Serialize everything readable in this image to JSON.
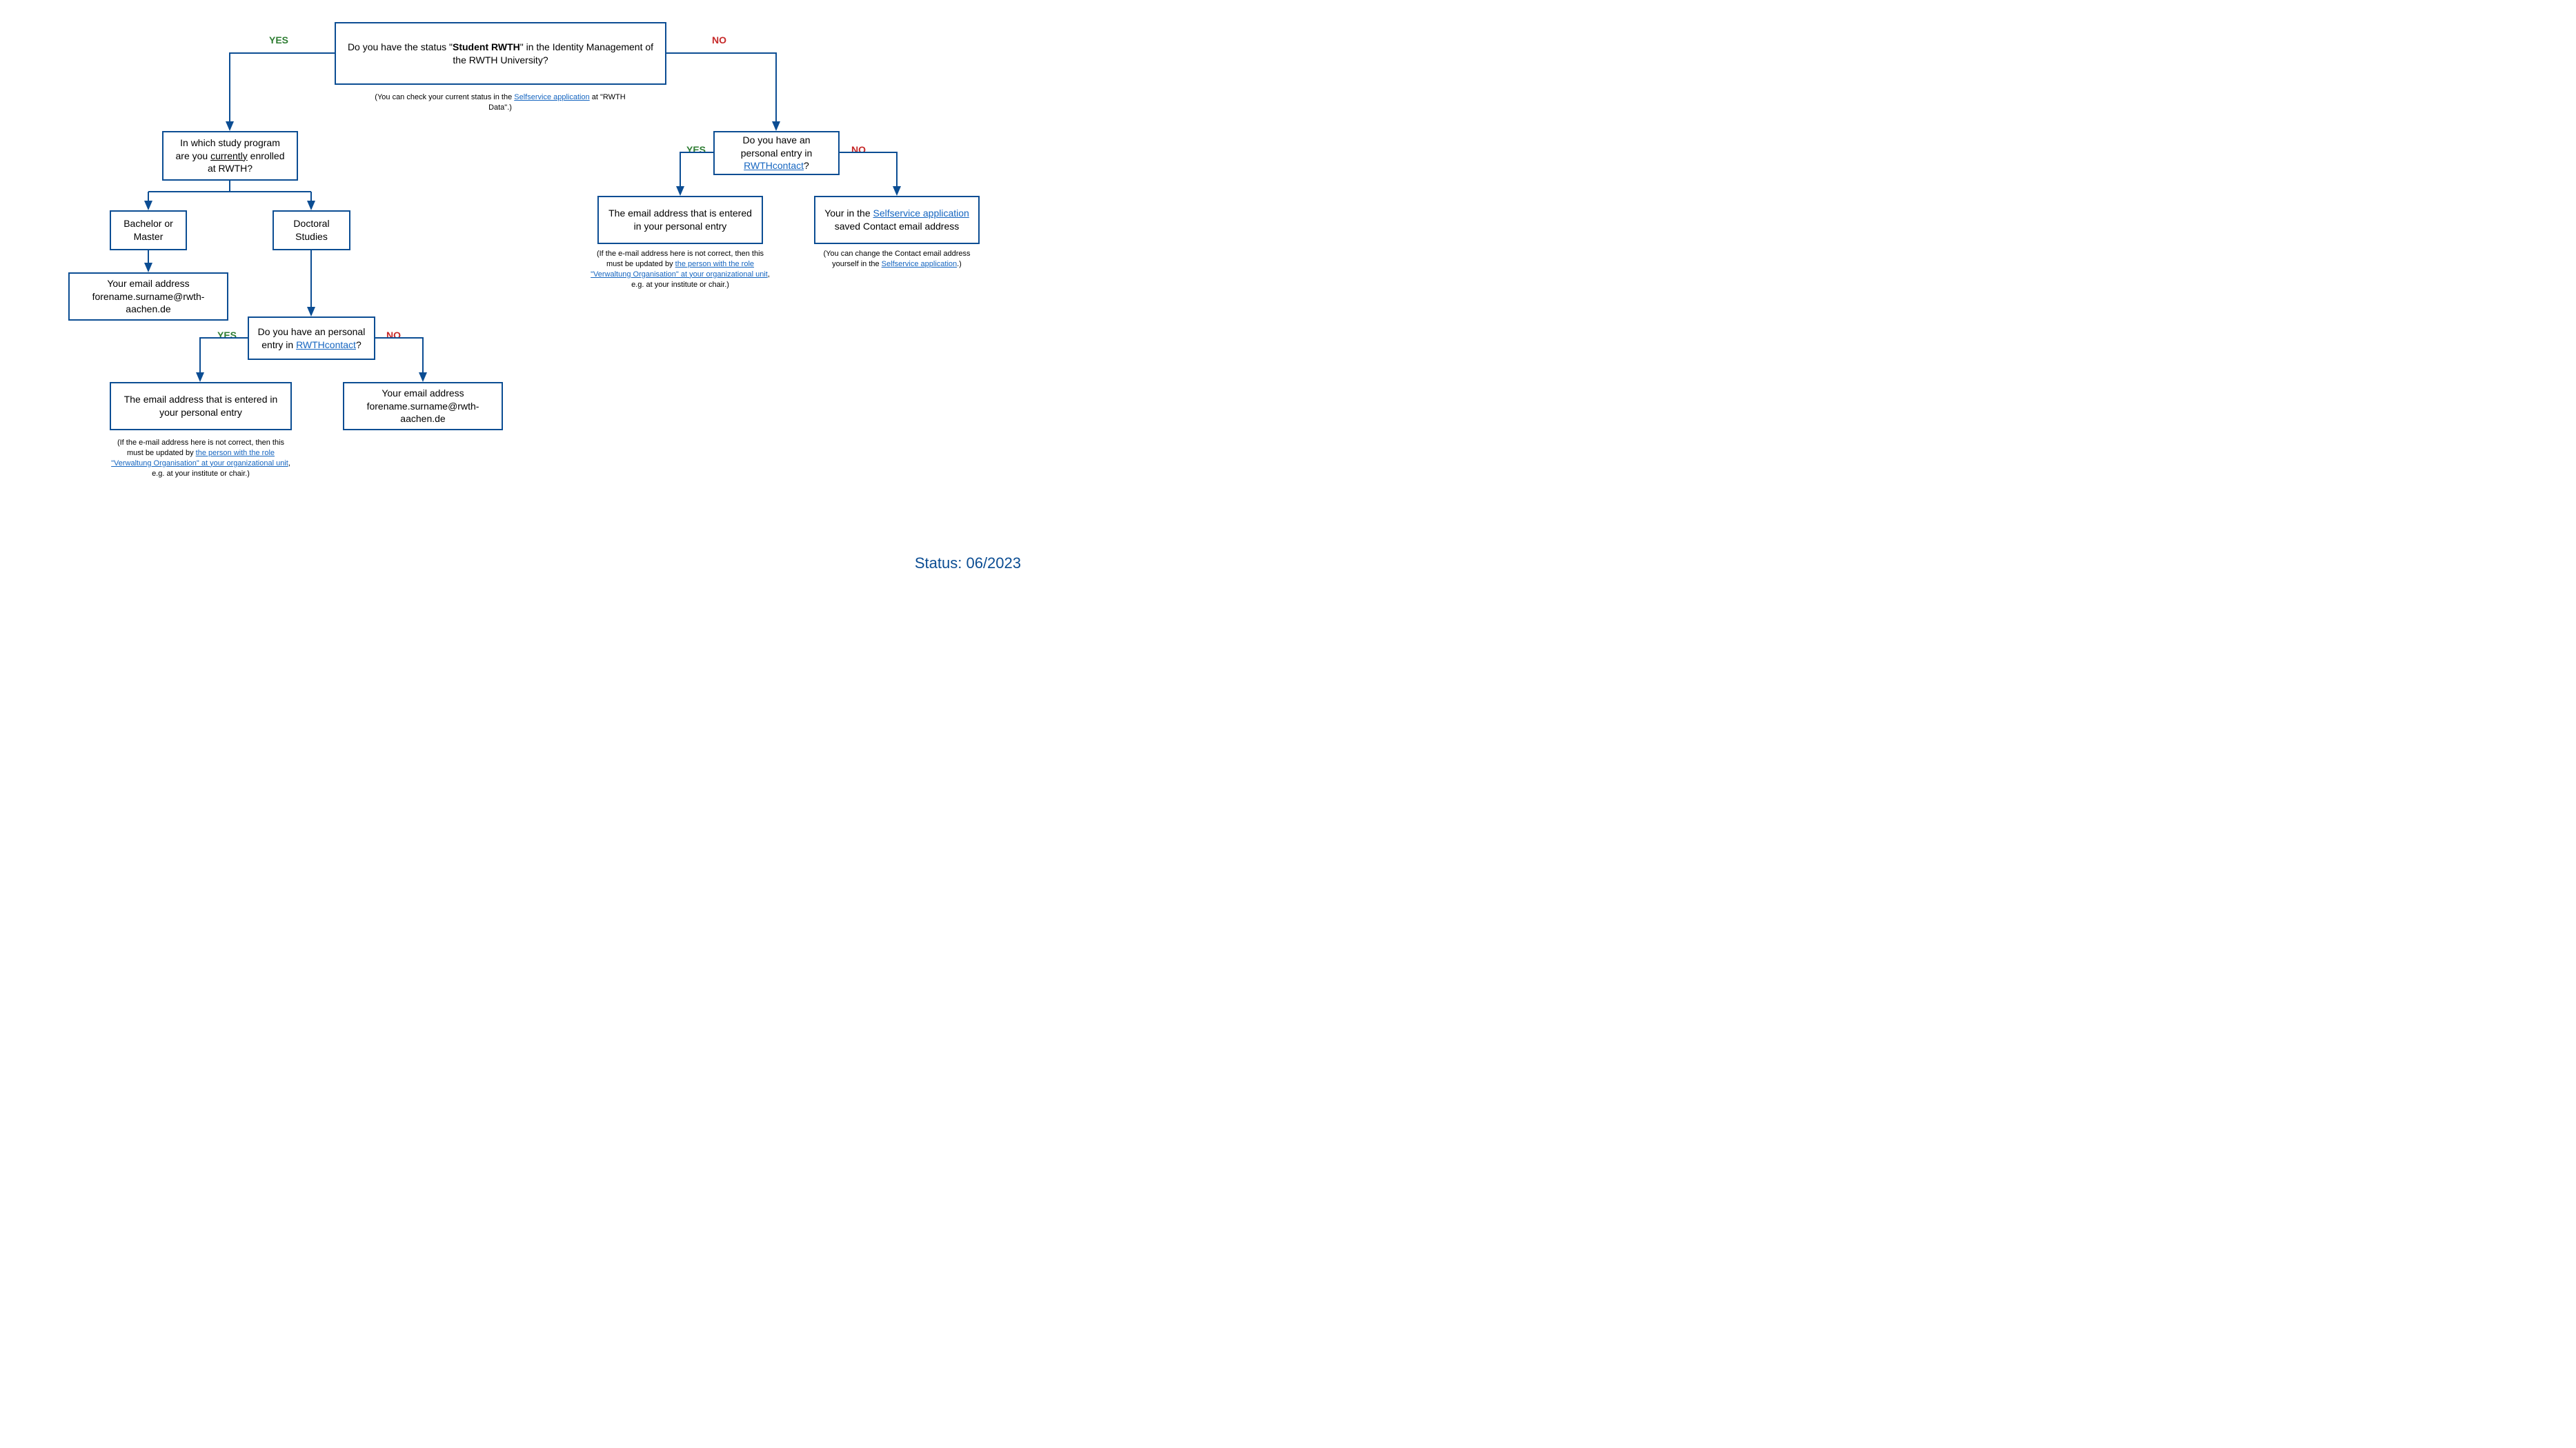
{
  "chart_data": {
    "type": "flowchart",
    "title": "RWTH email address decision tree",
    "nodes": [
      {
        "id": "root",
        "kind": "decision",
        "text": "Do you have the status \"Student RWTH\" in the Identity Management of the RWTH University?",
        "note": "(You can check your current status in the Selfservice application at \"RWTH Data\".)"
      },
      {
        "id": "study",
        "kind": "decision",
        "text": "In which study program are you currently enrolled at RWTH?"
      },
      {
        "id": "bama",
        "kind": "option",
        "text": "Bachelor or Master"
      },
      {
        "id": "phd",
        "kind": "option",
        "text": "Doctoral Studies"
      },
      {
        "id": "emailA",
        "kind": "result",
        "text": "Your email address forename.surname@rwth-aachen.de"
      },
      {
        "id": "contact1",
        "kind": "decision",
        "text": "Do you have an personal entry in RWTHcontact?"
      },
      {
        "id": "emailB",
        "kind": "result",
        "text": "The email address that is entered in your personal entry",
        "note": "(If the e-mail address here is not correct, then this must be updated by the person with the role \"Verwaltung Organisation\" at your organizational unit, e.g. at your institute or chair.)"
      },
      {
        "id": "emailC",
        "kind": "result",
        "text": "Your email address forename.surname@rwth-aachen.de"
      },
      {
        "id": "contact2",
        "kind": "decision",
        "text": "Do you have an personal entry in RWTHcontact?"
      },
      {
        "id": "emailD",
        "kind": "result",
        "text": "The email address that is entered in your personal entry",
        "note": "(If the e-mail address here is not correct, then this must be updated by the person with the role \"Verwaltung Organisation\" at your organizational unit, e.g. at your institute or chair.)"
      },
      {
        "id": "emailE",
        "kind": "result",
        "text": "Your in the Selfservice application saved Contact email address",
        "note": "(You can change the Contact email address yourself in the Selfservice application.)"
      }
    ],
    "edges": [
      {
        "from": "root",
        "to": "study",
        "label": "YES"
      },
      {
        "from": "root",
        "to": "contact2",
        "label": "NO"
      },
      {
        "from": "study",
        "to": "bama",
        "label": ""
      },
      {
        "from": "study",
        "to": "phd",
        "label": ""
      },
      {
        "from": "bama",
        "to": "emailA",
        "label": ""
      },
      {
        "from": "phd",
        "to": "contact1",
        "label": ""
      },
      {
        "from": "contact1",
        "to": "emailB",
        "label": "YES"
      },
      {
        "from": "contact1",
        "to": "emailC",
        "label": "NO"
      },
      {
        "from": "contact2",
        "to": "emailD",
        "label": "YES"
      },
      {
        "from": "contact2",
        "to": "emailE",
        "label": "NO"
      }
    ]
  },
  "labels": {
    "yes": "YES",
    "no": "NO",
    "status": "Status: 06/2023"
  },
  "root": {
    "pre": "Do you have the status \"",
    "bold": "Student RWTH",
    "post": "\" in the Identity Management of the RWTH University?",
    "note_pre": "(You can check your current status in the ",
    "note_link": "Selfservice application",
    "note_post": " at \"RWTH Data\".)"
  },
  "study": {
    "l1": "In which study program",
    "l2_pre": "are you ",
    "l2_u": "currently",
    "l2_post": " enrolled",
    "l3": "at RWTH?"
  },
  "bama": "Bachelor or Master",
  "phd": "Doctoral Studies",
  "emailA": {
    "l1": "Your email address",
    "l2": "forename.surname@rwth-aachen.de"
  },
  "contact1": {
    "pre": "Do you have an personal entry in ",
    "link": "RWTHcontact",
    "post": "?"
  },
  "emailB": "The email address that is entered in your personal entry",
  "noteB": {
    "pre": "(If the e-mail address here is not correct, then this must be updated by ",
    "link": "the person with the role \"Verwaltung Organisation\" at your organizational unit",
    "post": ", e.g. at your institute or chair.)"
  },
  "emailC": {
    "l1": "Your email address",
    "l2": "forename.surname@rwth-aachen.de"
  },
  "contact2": {
    "pre": "Do you have an personal entry in ",
    "link": "RWTHcontact",
    "post": "?"
  },
  "emailD": "The email address that is entered in your personal entry",
  "noteD": {
    "pre": "(If the e-mail address here is not correct, then this must be updated by ",
    "link": "the person with the role \"Verwaltung Organisation\" at your organizational unit",
    "post": ", e.g. at your institute or chair.)"
  },
  "emailE": {
    "pre": "Your in the ",
    "link": "Selfservice application",
    "post": " saved Contact email address"
  },
  "noteE": {
    "pre": "(You can change the Contact email address yourself in the ",
    "link": "Selfservice application",
    "post": ".)"
  }
}
